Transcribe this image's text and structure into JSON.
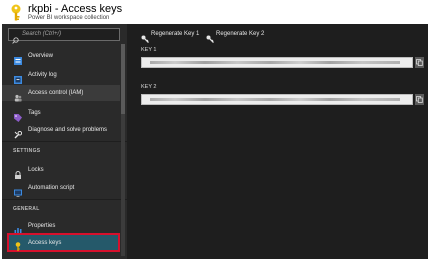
{
  "header": {
    "title": "rkpbi - Access keys",
    "subtitle": "Power BI workspace collection"
  },
  "search": {
    "placeholder": "Search (Ctrl+/)"
  },
  "menu": {
    "items": [
      {
        "label": "Overview",
        "icon": "overview-icon"
      },
      {
        "label": "Activity log",
        "icon": "activity-log-icon"
      },
      {
        "label": "Access control (IAM)",
        "icon": "people-icon"
      },
      {
        "label": "Tags",
        "icon": "tag-icon"
      },
      {
        "label": "Diagnose and solve problems",
        "icon": "wrench-icon"
      }
    ],
    "settings_heading": "SETTINGS",
    "settings_items": [
      {
        "label": "Locks",
        "icon": "lock-icon"
      },
      {
        "label": "Automation script",
        "icon": "script-icon"
      }
    ],
    "general_heading": "GENERAL",
    "general_items": [
      {
        "label": "Properties",
        "icon": "properties-icon"
      },
      {
        "label": "Access keys",
        "icon": "key-icon"
      }
    ]
  },
  "toolbar": {
    "regenerate_key1": "Regenerate Key 1",
    "regenerate_key2": "Regenerate Key 2"
  },
  "keys": {
    "key1_label": "KEY 1",
    "key2_label": "KEY 2"
  },
  "colors": {
    "accent_key": "#f0c419",
    "selected_bg": "#25596a",
    "highlight_border": "#d7102c"
  }
}
